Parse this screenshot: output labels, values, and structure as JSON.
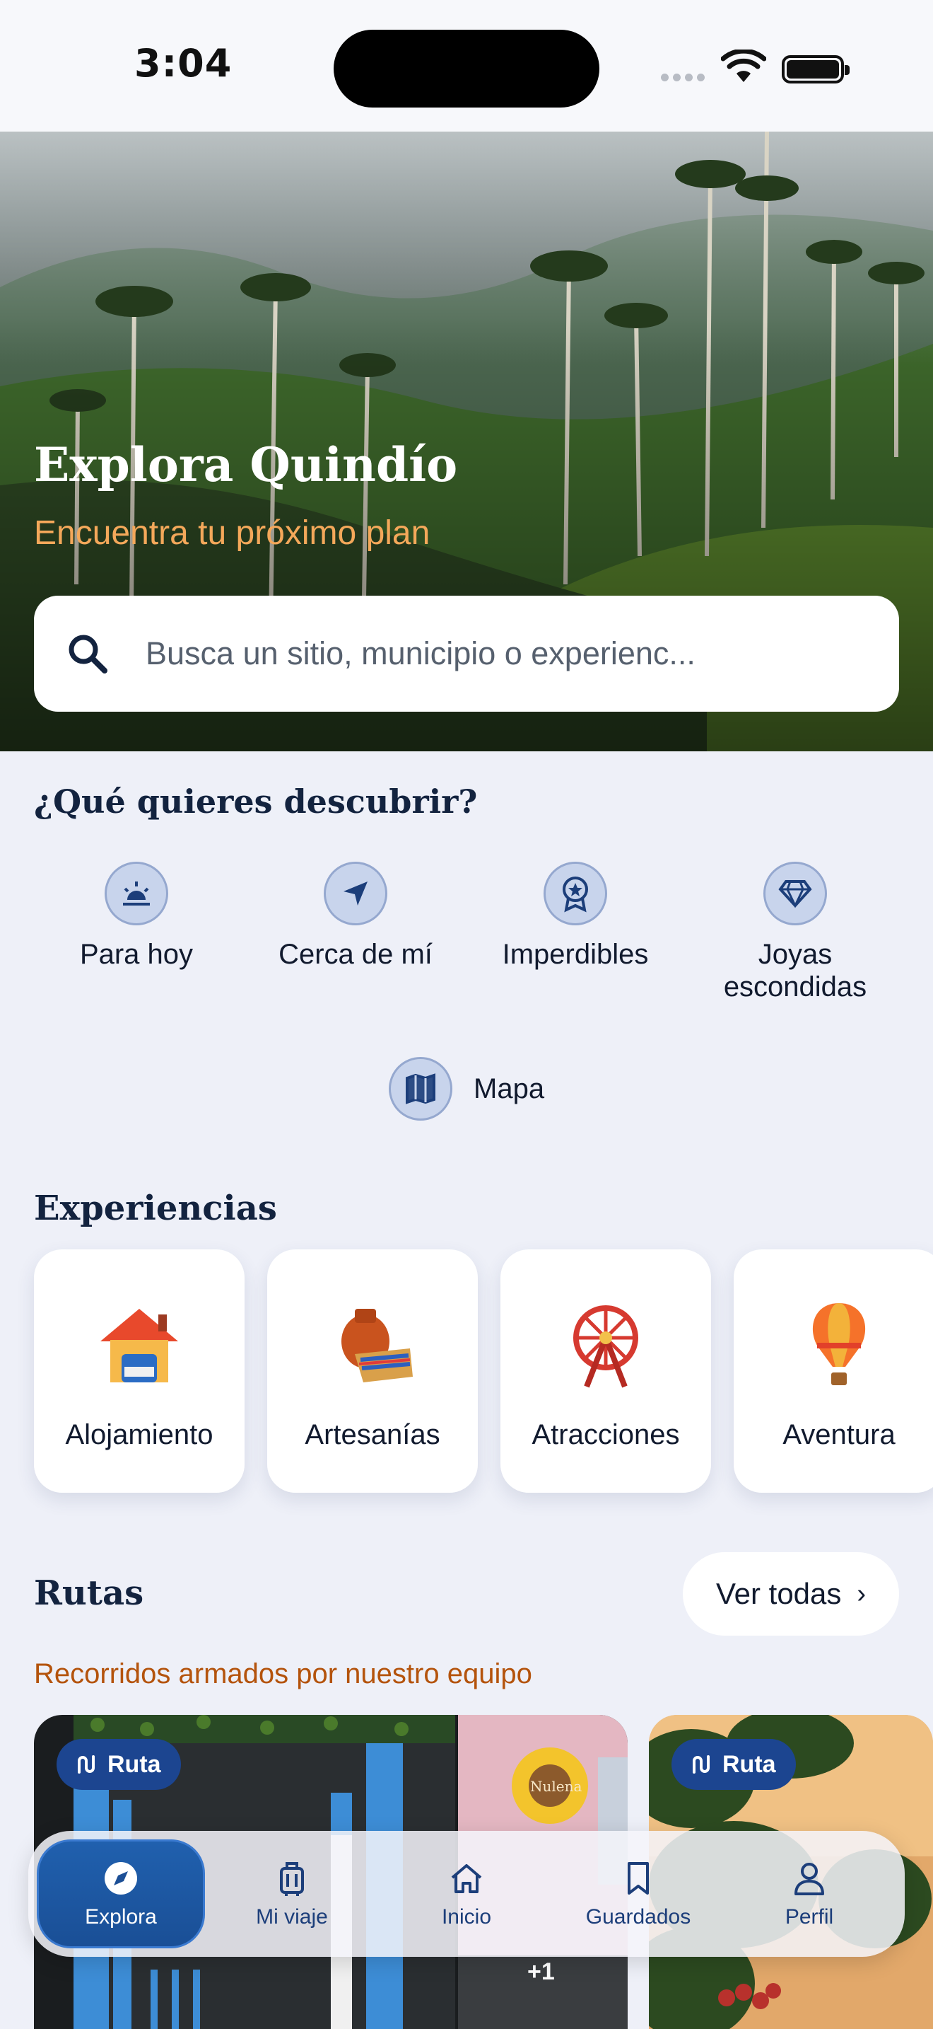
{
  "status_bar": {
    "time": "3:04"
  },
  "hero": {
    "title": "Explora Quindío",
    "subtitle": "Encuentra tu próximo plan",
    "search_placeholder": "Busca un sitio, municipio o experienc..."
  },
  "discover": {
    "title": "¿Qué quieres descubrir?",
    "items": [
      {
        "label": "Para hoy",
        "icon": "sunrise-icon"
      },
      {
        "label": "Cerca de mí",
        "icon": "navigation-arrow-icon"
      },
      {
        "label": "Imperdibles",
        "icon": "badge-star-icon"
      },
      {
        "label": "Joyas escondidas",
        "icon": "diamond-icon"
      }
    ],
    "map_label": "Mapa"
  },
  "experiences": {
    "title": "Experiencias",
    "items": [
      {
        "label": "Alojamiento",
        "icon": "house-icon"
      },
      {
        "label": "Artesanías",
        "icon": "crafts-icon"
      },
      {
        "label": "Atracciones",
        "icon": "ferris-wheel-icon"
      },
      {
        "label": "Aventura",
        "icon": "hot-air-balloon-icon"
      }
    ]
  },
  "routes": {
    "title": "Rutas",
    "see_all": "Ver todas",
    "subtitle": "Recorridos armados por nuestro equipo",
    "cards": [
      {
        "badge": "Ruta",
        "extra_count": "+1",
        "sign_text": "Nulena"
      },
      {
        "badge": "Ruta"
      }
    ]
  },
  "tabbar": {
    "items": [
      {
        "label": "Explora",
        "icon": "compass-icon",
        "active": true
      },
      {
        "label": "Mi viaje",
        "icon": "luggage-icon",
        "active": false
      },
      {
        "label": "Inicio",
        "icon": "home-icon",
        "active": false
      },
      {
        "label": "Guardados",
        "icon": "bookmark-icon",
        "active": false
      },
      {
        "label": "Perfil",
        "icon": "user-icon",
        "active": false
      }
    ]
  },
  "colors": {
    "primary": "#1c4590",
    "accent_orange": "#f4a85a",
    "subtitle_orange": "#b4530c",
    "background": "#eef0f8"
  }
}
